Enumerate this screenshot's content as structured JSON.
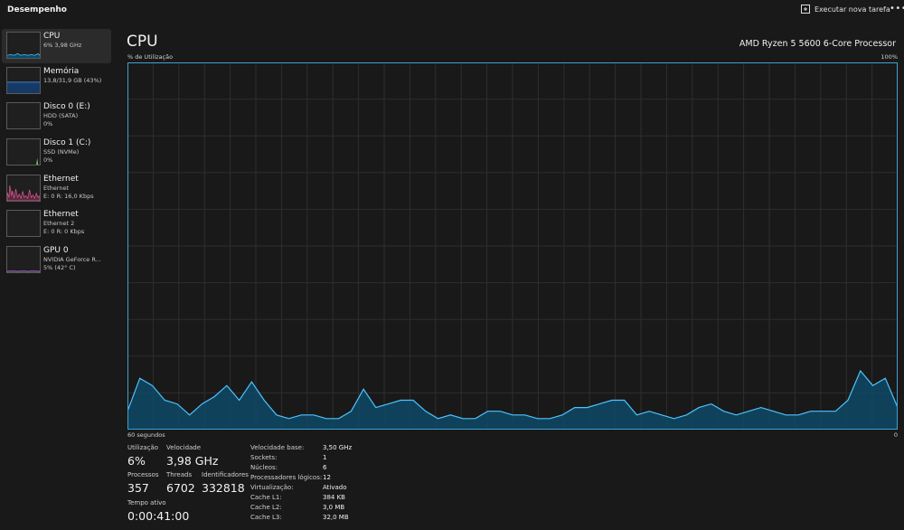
{
  "app": {
    "title": "Desempenho"
  },
  "toolbar": {
    "run_task_label": "Executar nova tarefa",
    "more_label": "•••"
  },
  "sidebar": {
    "items": [
      {
        "title": "CPU",
        "lines": [
          "6% 3,98 GHz"
        ],
        "color": "#4cc2ff"
      },
      {
        "title": "Memória",
        "lines": [
          "13,8/31,9 GB (43%)"
        ],
        "color": "#4c9bff"
      },
      {
        "title": "Disco 0 (E:)",
        "lines": [
          "HDD (SATA)",
          "0%"
        ],
        "color": "#7ad36b"
      },
      {
        "title": "Disco 1 (C:)",
        "lines": [
          "SSD (NVMe)",
          "0%"
        ],
        "color": "#7ad36b"
      },
      {
        "title": "Ethernet",
        "lines": [
          "Ethernet",
          "E: 0 R: 16,0 Kbps"
        ],
        "color": "#e35d94"
      },
      {
        "title": "Ethernet",
        "lines": [
          "Ethernet 2",
          "E: 0 R: 0 Kbps"
        ],
        "color": "#e35d94"
      },
      {
        "title": "GPU 0",
        "lines": [
          "NVIDIA GeForce R...",
          "5% (42° C)"
        ],
        "color": "#b07cd8"
      }
    ]
  },
  "main": {
    "title": "CPU",
    "processor": "AMD Ryzen 5 5600 6-Core Processor",
    "axis": {
      "top_left": "% de Utilização",
      "top_right": "100%",
      "bottom_left": "60 segundos",
      "bottom_right": "0"
    }
  },
  "chart_data": {
    "type": "area",
    "ylim": [
      0,
      100
    ],
    "xlim": [
      60,
      0
    ],
    "grid": true,
    "color": "#4cc2ff",
    "fill": "#0e4a66",
    "values": [
      5,
      14,
      12,
      8,
      7,
      4,
      7,
      9,
      12,
      8,
      13,
      8,
      4,
      3,
      4,
      4,
      3,
      3,
      5,
      11,
      6,
      7,
      8,
      8,
      5,
      3,
      4,
      3,
      3,
      5,
      5,
      4,
      4,
      3,
      3,
      4,
      6,
      6,
      7,
      8,
      8,
      4,
      5,
      4,
      3,
      4,
      6,
      7,
      5,
      4,
      5,
      6,
      5,
      4,
      4,
      5,
      5,
      5,
      8,
      16,
      12,
      14,
      6
    ]
  },
  "stats": {
    "utilization": {
      "label": "Utilização",
      "value": "6%"
    },
    "speed": {
      "label": "Velocidade",
      "value": "3,98 GHz"
    },
    "processes": {
      "label": "Processos",
      "value": "357"
    },
    "threads": {
      "label": "Threads",
      "value": "6702"
    },
    "handles": {
      "label": "Identificadores",
      "value": "332818"
    },
    "uptime": {
      "label": "Tempo ativo",
      "value": "0:00:41:00"
    }
  },
  "details": [
    {
      "label": "Velocidade base:",
      "value": "3,50 GHz"
    },
    {
      "label": "Sockets:",
      "value": "1"
    },
    {
      "label": "Núcleos:",
      "value": "6"
    },
    {
      "label": "Processadores lógicos:",
      "value": "12"
    },
    {
      "label": "Virtualização:",
      "value": "Ativado"
    },
    {
      "label": "Cache L1:",
      "value": "384 KB"
    },
    {
      "label": "Cache L2:",
      "value": "3,0 MB"
    },
    {
      "label": "Cache L3:",
      "value": "32,0 MB"
    }
  ]
}
